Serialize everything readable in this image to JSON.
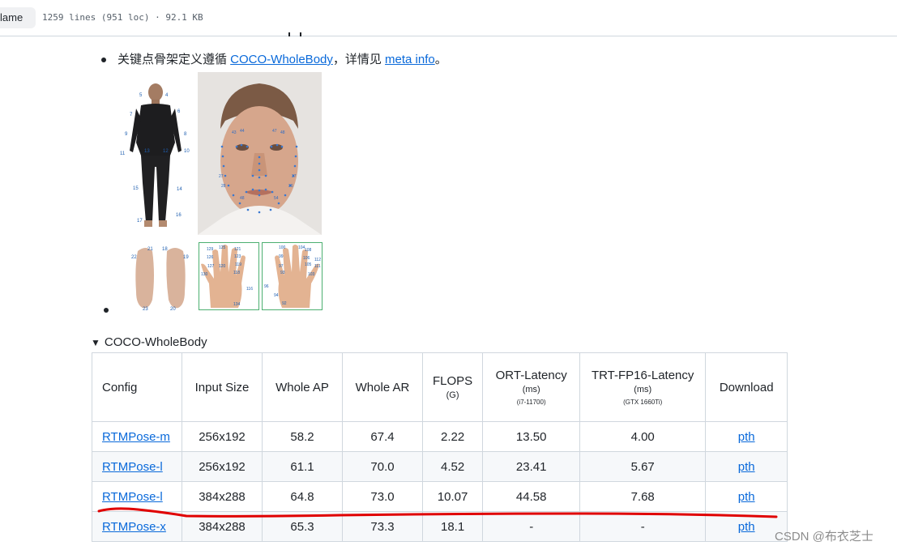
{
  "topbar": {
    "blame_label": "lame",
    "file_meta": "1259 lines (951 loc) · 92.1 KB"
  },
  "intro": {
    "prefix": "关键点骨架定义遵循 ",
    "link1": "COCO-WholeBody",
    "middle": "，详情见 ",
    "link2": "meta info",
    "suffix": "。"
  },
  "figures": {
    "body_labels": [
      "5",
      "4",
      "7",
      "6",
      "9",
      "8",
      "11",
      "13",
      "12",
      "10",
      "15",
      "14",
      "17",
      "16"
    ],
    "feet_labels": [
      "21",
      "18",
      "22",
      "19",
      "23",
      "20"
    ],
    "face_labels": [
      "27",
      "28",
      "37",
      "36",
      "48",
      "54",
      "43",
      "44",
      "47",
      "48"
    ],
    "left_hand_labels": [
      "129",
      "126",
      "125",
      "121",
      "123",
      "119",
      "130",
      "120",
      "127",
      "118",
      "116",
      "134"
    ],
    "right_hand_labels": [
      "100",
      "104",
      "108",
      "105",
      "112",
      "99",
      "97",
      "106",
      "111",
      "93",
      "103",
      "96",
      "94",
      "92"
    ]
  },
  "summary": {
    "marker": "▼",
    "title": "COCO-WholeBody"
  },
  "table": {
    "headers": [
      {
        "main": "Config",
        "sub1": "",
        "sub2": ""
      },
      {
        "main": "Input Size",
        "sub1": "",
        "sub2": ""
      },
      {
        "main": "Whole AP",
        "sub1": "",
        "sub2": ""
      },
      {
        "main": "Whole AR",
        "sub1": "",
        "sub2": ""
      },
      {
        "main": "FLOPS",
        "sub1": "(G)",
        "sub2": ""
      },
      {
        "main": "ORT-Latency",
        "sub1": "(ms)",
        "sub2": "(i7-11700)"
      },
      {
        "main": "TRT-FP16-Latency",
        "sub1": "(ms)",
        "sub2": "(GTX 1660Ti)"
      },
      {
        "main": "Download",
        "sub1": "",
        "sub2": ""
      }
    ],
    "rows": [
      [
        "RTMPose-m",
        "256x192",
        "58.2",
        "67.4",
        "2.22",
        "13.50",
        "4.00",
        "pth"
      ],
      [
        "RTMPose-l",
        "256x192",
        "61.1",
        "70.0",
        "4.52",
        "23.41",
        "5.67",
        "pth"
      ],
      [
        "RTMPose-l",
        "384x288",
        "64.8",
        "73.0",
        "10.07",
        "44.58",
        "7.68",
        "pth"
      ],
      [
        "RTMPose-x",
        "384x288",
        "65.3",
        "73.3",
        "18.1",
        "-",
        "-",
        "pth"
      ]
    ]
  },
  "annotation_color": "#e00000",
  "watermark": "CSDN @布衣芝士"
}
